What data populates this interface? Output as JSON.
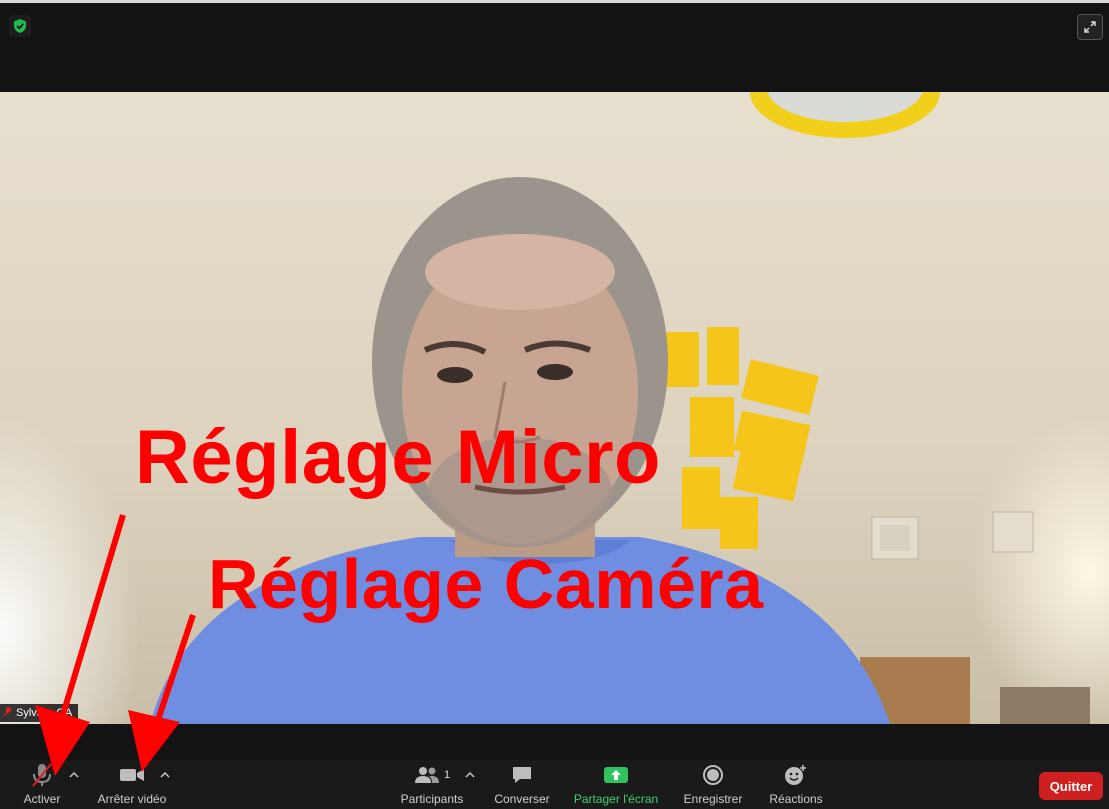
{
  "meeting": {
    "participant_name": "Sylvai…GA",
    "participant_count": "1"
  },
  "toolbar": {
    "activer_label": "Activer",
    "video_label": "Arrêter vidéo",
    "participants_label": "Participants",
    "converser_label": "Converser",
    "partager_label": "Partager l'écran",
    "enregistrer_label": "Enregistrer",
    "reactions_label": "Réactions",
    "quit_label": "Quitter"
  },
  "annotations": {
    "micro": "Réglage Micro",
    "camera": "Réglage Caméra"
  },
  "colors": {
    "annotation": "#ff0000",
    "share_green": "#3ad16f",
    "quit_red": "#cf1f1f",
    "shield_green": "#1fbf4f"
  },
  "icons": [
    "shield-icon",
    "fullscreen-icon",
    "microphone-muted-icon",
    "camera-icon",
    "participants-icon",
    "chat-icon",
    "share-screen-icon",
    "record-icon",
    "reactions-icon",
    "caret-up-icon"
  ]
}
